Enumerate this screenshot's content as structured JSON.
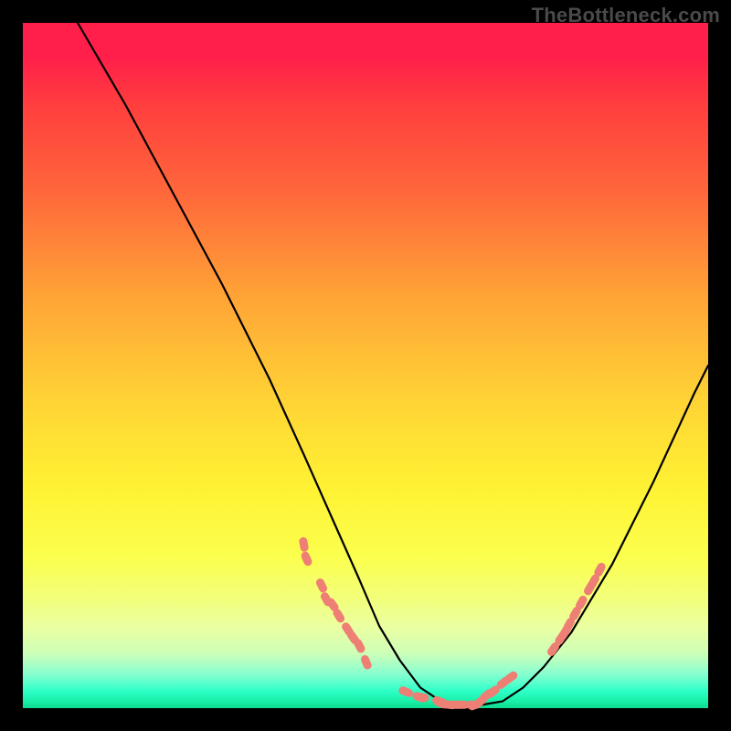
{
  "watermark": "TheBottleneck.com",
  "chart_data": {
    "type": "line",
    "title": "",
    "xlabel": "",
    "ylabel": "",
    "xlim": [
      0,
      100
    ],
    "ylim": [
      0,
      100
    ],
    "grid": false,
    "legend": false,
    "series": [
      {
        "name": "bottleneck-curve",
        "x": [
          8,
          15,
          22,
          29,
          36,
          41,
          45,
          49,
          52,
          55,
          58,
          61,
          64,
          67,
          70,
          73,
          76,
          80,
          86,
          92,
          98,
          100
        ],
        "y": [
          100,
          88,
          75,
          62,
          48,
          37,
          28,
          19,
          12,
          7,
          3,
          1,
          0.5,
          0.5,
          1,
          3,
          6,
          11,
          21,
          33,
          46,
          50
        ],
        "color": "#000000"
      },
      {
        "name": "left-highlight-dots",
        "type": "scatter",
        "x": [
          41,
          41.4,
          43.6,
          44.3,
          45.2,
          46.1,
          47.4,
          48.2,
          49.1,
          50.1
        ],
        "y": [
          23.9,
          21.8,
          17.9,
          15.9,
          15.1,
          13.5,
          11.5,
          10.3,
          9.1,
          6.7
        ],
        "color": "#ee7f74"
      },
      {
        "name": "floor-highlight-dots",
        "type": "scatter",
        "x": [
          55.9,
          57.9,
          58.2,
          60.8,
          61.1,
          62.3,
          63.1,
          64.0,
          65.7,
          66.0,
          66.8,
          67.7,
          68.6,
          70.1,
          71.2
        ],
        "y": [
          2.4,
          1.6,
          1.6,
          1.0,
          0.7,
          0.5,
          0.5,
          0.5,
          0.5,
          0.5,
          1.0,
          1.9,
          2.4,
          3.7,
          4.5
        ],
        "color": "#ee7f74"
      },
      {
        "name": "right-highlight-dots",
        "type": "scatter",
        "x": [
          77.4,
          78.5,
          79.1,
          79.7,
          80.6,
          81.5,
          82.7,
          83.3,
          84.2
        ],
        "y": [
          8.6,
          10.2,
          11.1,
          12.2,
          13.8,
          15.4,
          17.5,
          18.5,
          20.2
        ],
        "color": "#ee7f74"
      }
    ],
    "background_gradient": {
      "direction": "top-to-bottom",
      "stops": [
        {
          "pos": 0.0,
          "color": "#ff1f4a"
        },
        {
          "pos": 0.25,
          "color": "#ff683b"
        },
        {
          "pos": 0.55,
          "color": "#ffd335"
        },
        {
          "pos": 0.78,
          "color": "#fbff4e"
        },
        {
          "pos": 0.92,
          "color": "#ceffb8"
        },
        {
          "pos": 1.0,
          "color": "#0fd98f"
        }
      ]
    }
  }
}
